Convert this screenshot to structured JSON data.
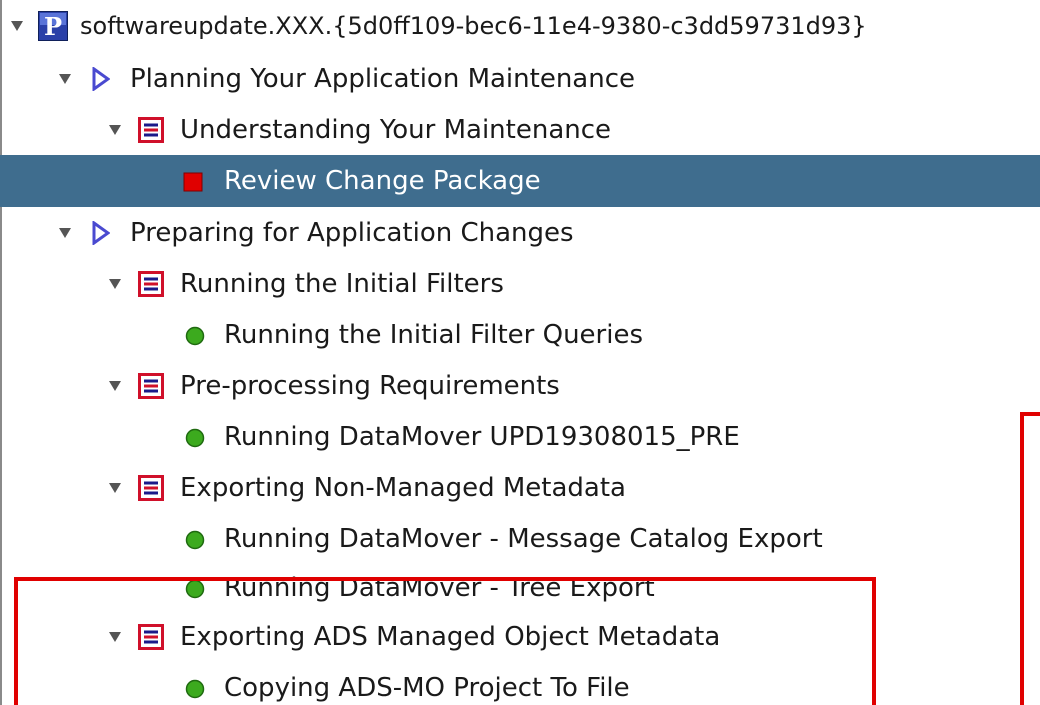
{
  "tree": {
    "root": {
      "label": "softwareupdate.XXX.{5d0ff109-bec6-11e4-9380-c3dd59731d93}",
      "icon": "project-icon",
      "expanded": true
    },
    "nodes": [
      {
        "label": "Planning Your Application Maintenance",
        "level": 1,
        "icon": "phase-arrow-icon",
        "expanded": true
      },
      {
        "label": "Understanding Your Maintenance",
        "level": 2,
        "icon": "task-list-icon",
        "expanded": true
      },
      {
        "label": "Review Change Package",
        "level": 3,
        "icon": "red-square-status-icon",
        "selected": true
      },
      {
        "label": "Preparing for Application Changes",
        "level": 1,
        "icon": "phase-arrow-icon",
        "expanded": true
      },
      {
        "label": "Running the Initial Filters",
        "level": 2,
        "icon": "task-list-icon",
        "expanded": true
      },
      {
        "label": "Running the Initial Filter Queries",
        "level": 3,
        "icon": "green-circle-status-icon"
      },
      {
        "label": "Pre-processing Requirements",
        "level": 2,
        "icon": "task-list-icon",
        "expanded": true
      },
      {
        "label": "Running DataMover UPD19308015_PRE",
        "level": 3,
        "icon": "green-circle-status-icon"
      },
      {
        "label": "Exporting Non-Managed Metadata",
        "level": 2,
        "icon": "task-list-icon",
        "expanded": true
      },
      {
        "label": "Running DataMover - Message Catalog Export",
        "level": 3,
        "icon": "green-circle-status-icon"
      },
      {
        "label": "Running DataMover - Tree Export",
        "level": 3,
        "icon": "green-circle-status-icon"
      },
      {
        "label": "Exporting ADS Managed Object Metadata",
        "level": 2,
        "icon": "task-list-icon",
        "expanded": true
      },
      {
        "label": "Copying ADS-MO Project To File",
        "level": 3,
        "icon": "green-circle-status-icon"
      }
    ]
  },
  "colors": {
    "selection": "#3f6d8e",
    "highlight_border": "#e00000",
    "status_green": "#3caa1e",
    "status_red": "#e00000",
    "task_icon": "#d0102a",
    "phase_icon": "#4a4ad0",
    "project_icon": "#2a40a8"
  }
}
